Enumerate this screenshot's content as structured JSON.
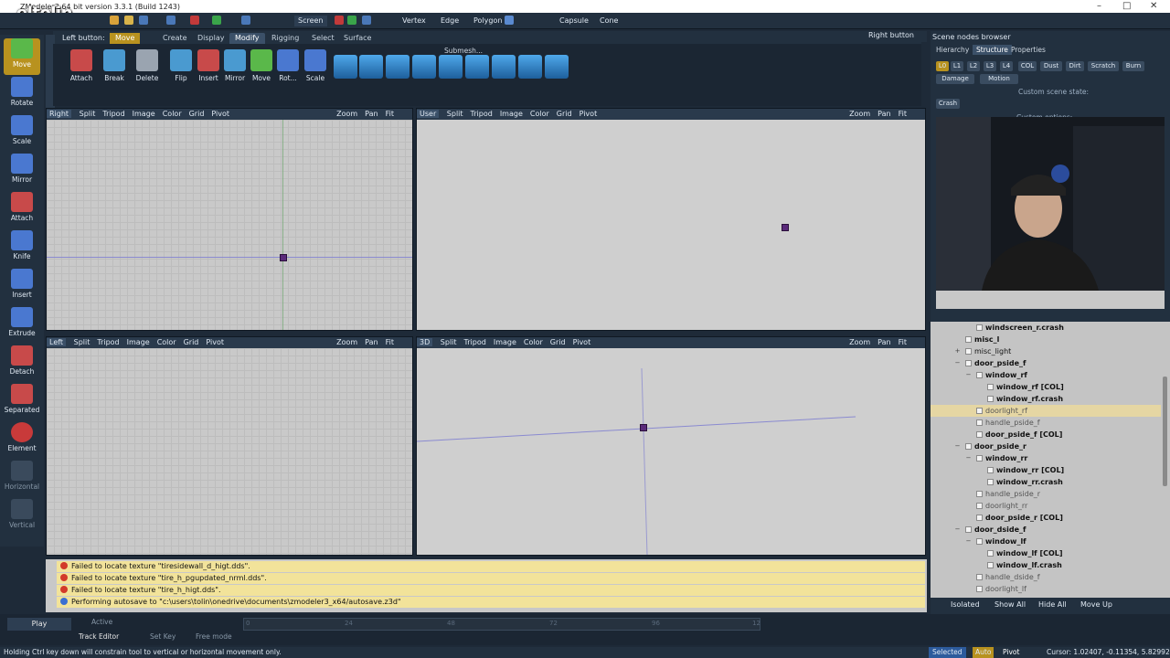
{
  "window": {
    "title": "ZModeler3 64 bit version 3.3.1 (Build 1243)",
    "watermark": "eltolin"
  },
  "topbar": {
    "screen_label": "Screen",
    "vertex": "Vertex",
    "edge": "Edge",
    "polygon": "Polygon",
    "capsule": "Capsule",
    "cone": "Cone"
  },
  "left_tools": [
    "Move",
    "Rotate",
    "Scale",
    "Mirror",
    "Attach",
    "Knife",
    "Insert",
    "Extrude",
    "Detach",
    "Separated",
    "Element",
    "Horizontal",
    "Vertical"
  ],
  "ribbon": {
    "left_button": "Left button:",
    "left_mode": "Move",
    "right_button": "Right button",
    "tabs": [
      "Create",
      "Display",
      "Modify",
      "Rigging",
      "Select",
      "Surface"
    ],
    "active_tab": "Modify",
    "buttons": [
      "Attach",
      "Break",
      "Delete",
      "Flip",
      "Insert",
      "Mirror",
      "Move",
      "Rot...",
      "Scale"
    ],
    "submesh_label": "Submesh..."
  },
  "viewports": [
    {
      "name": "Right",
      "menu": [
        "Split",
        "Tripod",
        "Image",
        "Color",
        "Grid",
        "Pivot"
      ],
      "right": [
        "Zoom",
        "Pan",
        "Fit"
      ]
    },
    {
      "name": "User",
      "menu": [
        "Split",
        "Tripod",
        "Image",
        "Color",
        "Grid",
        "Pivot"
      ],
      "right": [
        "Zoom",
        "Pan",
        "Fit"
      ]
    },
    {
      "name": "Left",
      "menu": [
        "Split",
        "Tripod",
        "Image",
        "Color",
        "Grid",
        "Pivot"
      ],
      "right": [
        "Zoom",
        "Pan",
        "Fit"
      ]
    },
    {
      "name": "3D",
      "menu": [
        "Split",
        "Tripod",
        "Image",
        "Color",
        "Grid",
        "Pivot"
      ],
      "right": [
        "Zoom",
        "Pan",
        "Fit"
      ]
    }
  ],
  "scene_panel": {
    "title": "Scene nodes browser",
    "tabs": [
      "Hierarchy",
      "Structure",
      "Properties"
    ],
    "active_tab": "Structure",
    "chips": [
      "L0",
      "L1",
      "L2",
      "L3",
      "L4",
      "COL",
      "Dust",
      "Dirt",
      "Scratch",
      "Burn"
    ],
    "damage": "Damage",
    "motion": "Motion",
    "custom_state": "Custom scene state:",
    "custom_options": "Custom options:",
    "crash": "Crash"
  },
  "tree": [
    {
      "label": "windscreen_r.crash",
      "level": 2,
      "bold": true
    },
    {
      "label": "misc_l",
      "level": 1,
      "bold": true
    },
    {
      "label": "misc_light",
      "level": 1,
      "bold": false,
      "expand": true
    },
    {
      "label": "door_pside_f",
      "level": 1,
      "bold": true,
      "expand": true
    },
    {
      "label": "window_rf",
      "level": 2,
      "bold": true,
      "expand": true
    },
    {
      "label": "window_rf [COL]",
      "level": 3,
      "bold": true
    },
    {
      "label": "window_rf.crash",
      "level": 3,
      "bold": true
    },
    {
      "label": "doorlight_rf",
      "level": 2,
      "bold": false,
      "hl": true
    },
    {
      "label": "handle_pside_f",
      "level": 2,
      "bold": false
    },
    {
      "label": "door_pside_f [COL]",
      "level": 2,
      "bold": true
    },
    {
      "label": "door_pside_r",
      "level": 1,
      "bold": true,
      "expand": true
    },
    {
      "label": "window_rr",
      "level": 2,
      "bold": true,
      "expand": true
    },
    {
      "label": "window_rr [COL]",
      "level": 3,
      "bold": true
    },
    {
      "label": "window_rr.crash",
      "level": 3,
      "bold": true
    },
    {
      "label": "handle_pside_r",
      "level": 2,
      "bold": false
    },
    {
      "label": "doorlight_rr",
      "level": 2,
      "bold": false
    },
    {
      "label": "door_pside_r [COL]",
      "level": 2,
      "bold": true
    },
    {
      "label": "door_dside_f",
      "level": 1,
      "bold": true,
      "expand": true
    },
    {
      "label": "window_lf",
      "level": 2,
      "bold": true,
      "expand": true
    },
    {
      "label": "window_lf [COL]",
      "level": 3,
      "bold": true
    },
    {
      "label": "window_lf.crash",
      "level": 3,
      "bold": true
    },
    {
      "label": "handle_dside_f",
      "level": 2,
      "bold": false
    },
    {
      "label": "doorlight_lf",
      "level": 2,
      "bold": false
    }
  ],
  "tree_toolbar": {
    "isolated": "Isolated",
    "show_all": "Show All",
    "hide_all": "Hide All",
    "move_up": "Move Up"
  },
  "log": [
    {
      "text": "Failed to locate texture \"tiresidewall_d_higt.dds\".",
      "type": "error"
    },
    {
      "text": "Failed to locate texture \"tire_h_pgupdated_nrml.dds\".",
      "type": "error"
    },
    {
      "text": "Failed to locate texture \"tire_h_higt.dds\".",
      "type": "error"
    },
    {
      "text": "Performing autosave to \"c:\\users\\tolin\\onedrive\\documents\\zmodeler3_x64/autosave.z3d\"",
      "type": "info"
    }
  ],
  "timeline": {
    "play": "Play",
    "active": "Active",
    "track_editor": "Track Editor",
    "set_key": "Set Key",
    "free_mode": "Free mode",
    "ticks": [
      "0",
      "24",
      "48",
      "72",
      "96",
      "12"
    ]
  },
  "status": {
    "hint": "Holding Ctrl key down will constrain tool to vertical or horizontal movement only.",
    "selected": "Selected",
    "auto": "Auto",
    "pivot": "Pivot",
    "cursor": "Cursor: 1.02407, -0.11354, 5.82992"
  },
  "colors": {
    "accent": "#b8921f",
    "panel": "#22303f",
    "viewport": "#c8c8c8",
    "pivot": "#5a2a7a"
  }
}
